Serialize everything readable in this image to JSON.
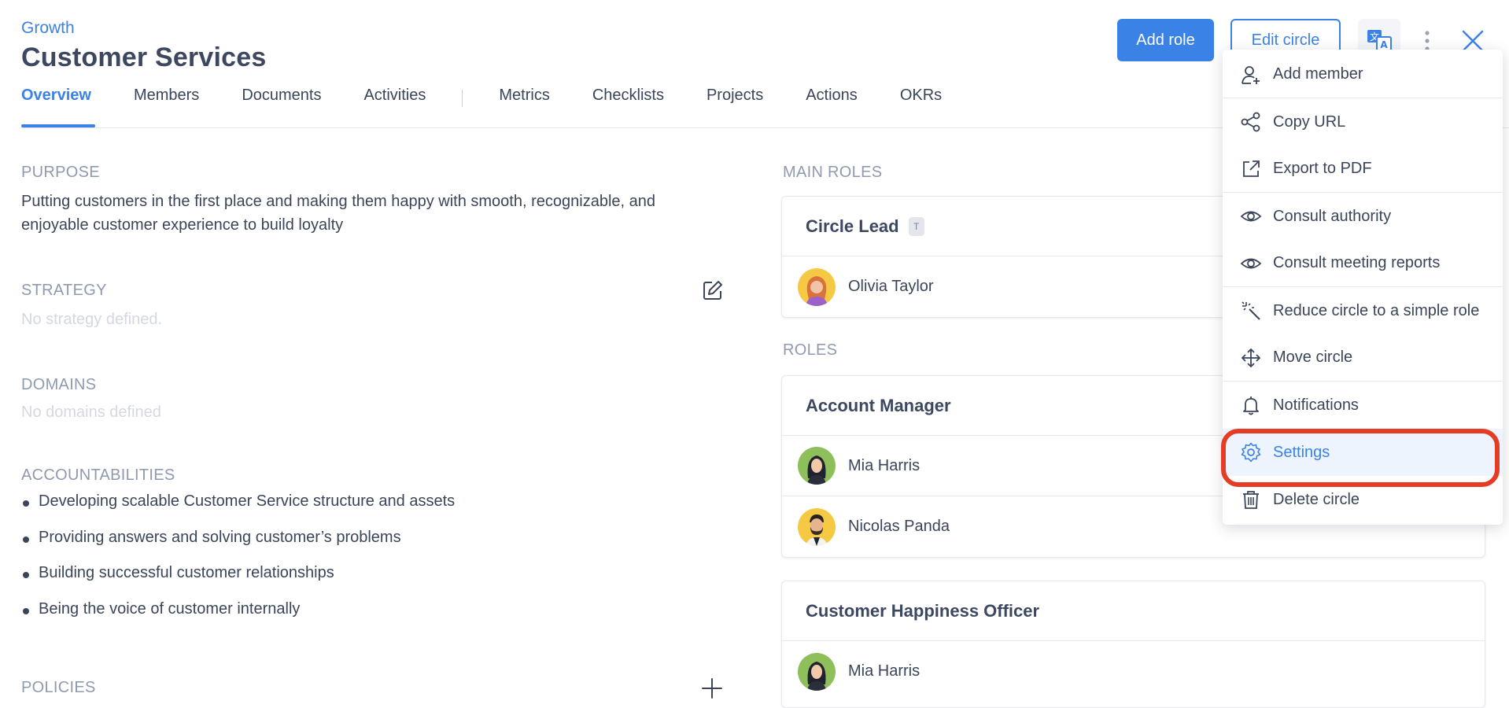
{
  "header": {
    "breadcrumb": "Growth",
    "title": "Customer Services",
    "add_role_label": "Add role",
    "edit_circle_label": "Edit circle",
    "translate_icon": "translate-icon",
    "more_icon": "more-vertical-icon",
    "close_icon": "close-icon"
  },
  "tabs": [
    {
      "label": "Overview",
      "active": true
    },
    {
      "label": "Members"
    },
    {
      "label": "Documents"
    },
    {
      "label": "Activities"
    },
    {
      "label": "Metrics"
    },
    {
      "label": "Checklists"
    },
    {
      "label": "Projects"
    },
    {
      "label": "Actions"
    },
    {
      "label": "OKRs"
    }
  ],
  "left": {
    "purpose_label": "PURPOSE",
    "purpose_text_1": "Putting customers in the first place and making them happy with smooth, recognizable, and",
    "purpose_text_2": "enjoyable customer experience to build loyalty",
    "strategy_label": "STRATEGY",
    "strategy_empty": "No strategy defined.",
    "domains_label": "DOMAINS",
    "domains_empty": "No domains defined",
    "accountabilities_label": "ACCOUNTABILITIES",
    "accountabilities": [
      "Developing scalable Customer Service structure and assets",
      "Providing answers and solving customer’s problems",
      "Building successful customer relationships",
      "Being the voice of customer internally"
    ],
    "policies_label": "POLICIES"
  },
  "right": {
    "main_roles_label": "MAIN ROLES",
    "roles_label": "ROLES",
    "circle_lead": {
      "title": "Circle Lead",
      "badge": "T",
      "members": [
        "Olivia Taylor"
      ]
    },
    "account_manager": {
      "title": "Account Manager",
      "members": [
        "Mia Harris",
        "Nicolas Panda"
      ]
    },
    "happiness_officer": {
      "title": "Customer Happiness Officer",
      "members": [
        "Mia Harris"
      ]
    }
  },
  "menu": {
    "items": [
      {
        "label": "Add member",
        "icon": "add-user-icon"
      },
      {
        "label": "Copy URL",
        "icon": "share-icon"
      },
      {
        "label": "Export to PDF",
        "icon": "external-link-icon"
      },
      {
        "label": "Consult authority",
        "icon": "eye-icon"
      },
      {
        "label": "Consult meeting reports",
        "icon": "eye-icon"
      },
      {
        "label": "Reduce circle to a simple role",
        "icon": "magic-wand-icon"
      },
      {
        "label": "Move circle",
        "icon": "move-icon"
      },
      {
        "label": "Notifications",
        "icon": "bell-icon"
      },
      {
        "label": "Settings",
        "icon": "gear-icon"
      },
      {
        "label": "Delete circle",
        "icon": "trash-icon"
      }
    ]
  },
  "colors": {
    "accent": "#3b82e6",
    "highlight_ring": "#e53c25",
    "muted_label": "#8f9ab0"
  }
}
